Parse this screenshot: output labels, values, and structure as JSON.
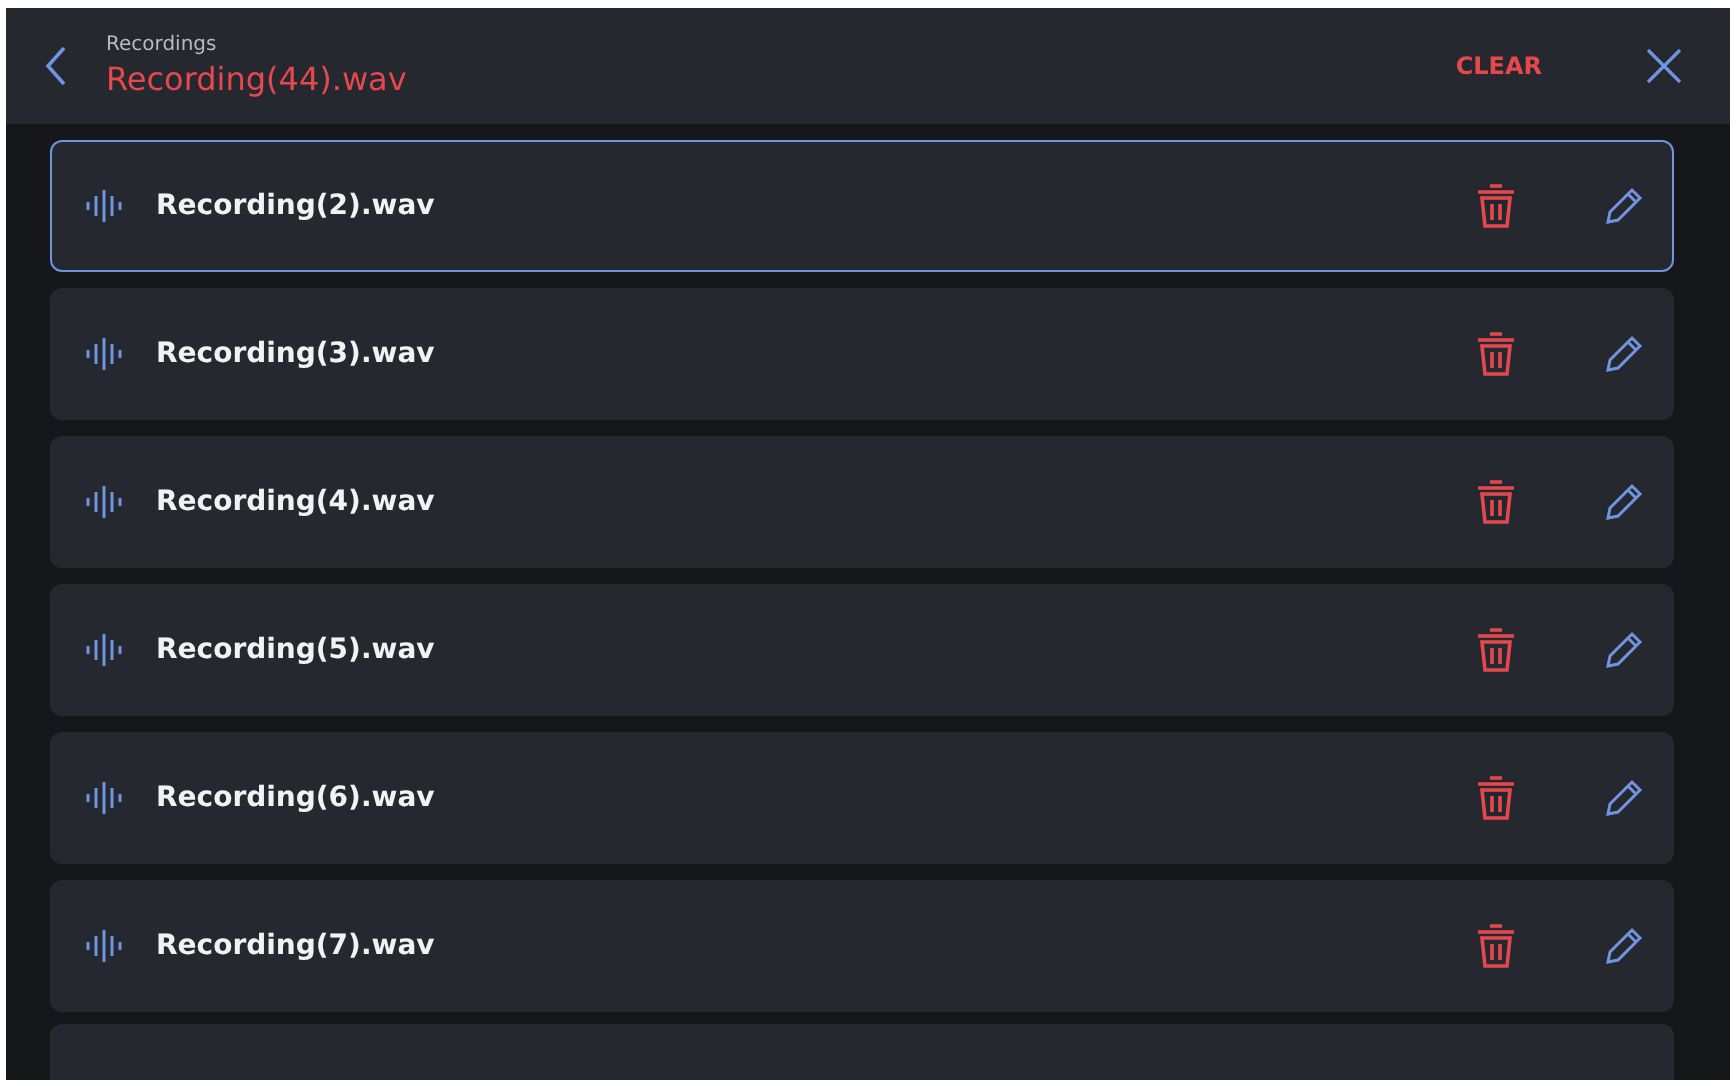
{
  "header": {
    "subtitle": "Recordings",
    "title": "Recording(44).wav",
    "clear_label": "CLEAR"
  },
  "recordings": [
    {
      "name": "Recording(2).wav",
      "selected": true
    },
    {
      "name": "Recording(3).wav",
      "selected": false
    },
    {
      "name": "Recording(4).wav",
      "selected": false
    },
    {
      "name": "Recording(5).wav",
      "selected": false
    },
    {
      "name": "Recording(6).wav",
      "selected": false
    },
    {
      "name": "Recording(7).wav",
      "selected": false
    }
  ]
}
